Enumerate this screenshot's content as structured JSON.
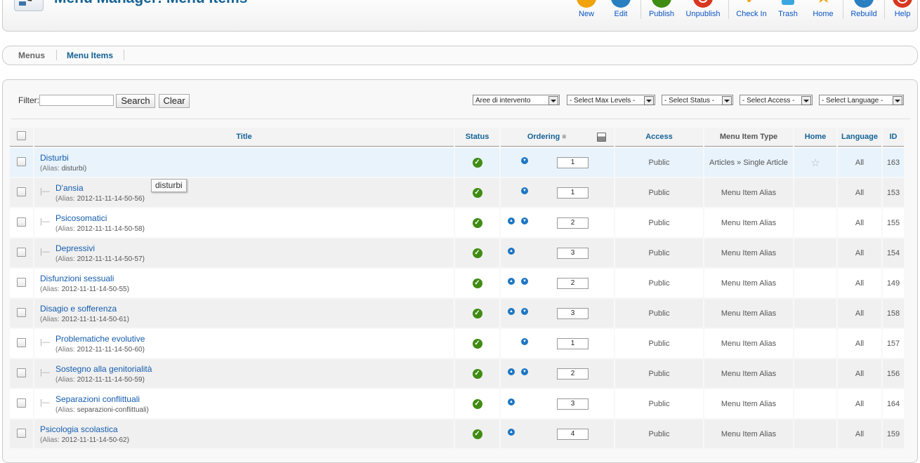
{
  "header": {
    "title": "Menu Manager: Menu Items",
    "buttons": [
      {
        "label": "New",
        "icon": "new-icon",
        "color": "#f0a30a"
      },
      {
        "label": "Edit",
        "icon": "edit-icon",
        "color": "#2a7fc1"
      },
      {
        "label": "Publish",
        "icon": "publish-icon",
        "color": "#3f8c12"
      },
      {
        "label": "Unpublish",
        "icon": "unpublish-icon",
        "color": "#d9381e"
      },
      {
        "label": "Check In",
        "icon": "check-in-icon",
        "color": "#f0a30a"
      },
      {
        "label": "Trash",
        "icon": "trash-icon",
        "color": "#3aa7e0"
      },
      {
        "label": "Home",
        "icon": "home-star-icon",
        "color": "#f0a30a"
      },
      {
        "label": "Rebuild",
        "icon": "rebuild-icon",
        "color": "#2a7fc1"
      },
      {
        "label": "Help",
        "icon": "help-icon",
        "color": "#d9381e"
      }
    ]
  },
  "submenu": {
    "menus": "Menus",
    "items": "Menu Items"
  },
  "filter": {
    "label": "Filter:",
    "value": "",
    "search": "Search",
    "clear": "Clear",
    "menu_select": "Aree di intervento",
    "levels_select": "- Select Max Levels -",
    "status_select": "- Select Status -",
    "access_select": "- Select Access -",
    "language_select": "- Select Language -"
  },
  "columns": {
    "title": "Title",
    "status": "Status",
    "ordering": "Ordering",
    "access": "Access",
    "type": "Menu Item Type",
    "home": "Home",
    "language": "Language",
    "id": "ID"
  },
  "alias_label": "(Alias:",
  "tooltip": "disturbi",
  "rows": [
    {
      "title": "Disturbi",
      "alias": "disturbi",
      "level": 1,
      "up": false,
      "down": true,
      "order": "1",
      "access": "Public",
      "type": "Articles » Single Article",
      "home": true,
      "language": "All",
      "id": "163"
    },
    {
      "title": "D'ansia",
      "alias": "2012-11-11-14-50-56",
      "level": 2,
      "up": false,
      "down": true,
      "order": "1",
      "access": "Public",
      "type": "Menu Item Alias",
      "home": false,
      "language": "All",
      "id": "153"
    },
    {
      "title": "Psicosomatici",
      "alias": "2012-11-11-14-50-58",
      "level": 2,
      "up": true,
      "down": true,
      "order": "2",
      "access": "Public",
      "type": "Menu Item Alias",
      "home": false,
      "language": "All",
      "id": "155"
    },
    {
      "title": "Depressivi",
      "alias": "2012-11-11-14-50-57",
      "level": 2,
      "up": true,
      "down": false,
      "order": "3",
      "access": "Public",
      "type": "Menu Item Alias",
      "home": false,
      "language": "All",
      "id": "154"
    },
    {
      "title": "Disfunzioni sessuali",
      "alias": "2012-11-11-14-50-55",
      "level": 1,
      "up": true,
      "down": true,
      "order": "2",
      "access": "Public",
      "type": "Menu Item Alias",
      "home": false,
      "language": "All",
      "id": "149"
    },
    {
      "title": "Disagio e sofferenza",
      "alias": "2012-11-11-14-50-61",
      "level": 1,
      "up": true,
      "down": true,
      "order": "3",
      "access": "Public",
      "type": "Menu Item Alias",
      "home": false,
      "language": "All",
      "id": "158"
    },
    {
      "title": "Problematiche evolutive",
      "alias": "2012-11-11-14-50-60",
      "level": 2,
      "up": false,
      "down": true,
      "order": "1",
      "access": "Public",
      "type": "Menu Item Alias",
      "home": false,
      "language": "All",
      "id": "157"
    },
    {
      "title": "Sostegno alla genitorialità",
      "alias": "2012-11-11-14-50-59",
      "level": 2,
      "up": true,
      "down": true,
      "order": "2",
      "access": "Public",
      "type": "Menu Item Alias",
      "home": false,
      "language": "All",
      "id": "156"
    },
    {
      "title": "Separazioni conflittuali",
      "alias": "separazioni-conflittuali",
      "level": 2,
      "up": true,
      "down": false,
      "order": "3",
      "access": "Public",
      "type": "Menu Item Alias",
      "home": false,
      "language": "All",
      "id": "164"
    },
    {
      "title": "Psicologia scolastica",
      "alias": "2012-11-11-14-50-62",
      "level": 1,
      "up": true,
      "down": false,
      "order": "4",
      "access": "Public",
      "type": "Menu Item Alias",
      "home": false,
      "language": "All",
      "id": "159"
    }
  ]
}
